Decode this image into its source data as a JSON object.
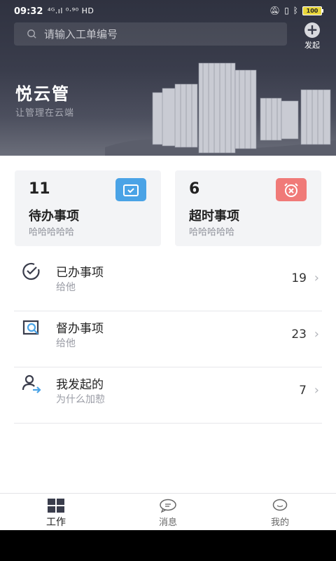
{
  "status_bar": {
    "time": "09:32",
    "network": "⁴ᴳ.ıl ⁰·⁹⁰ HD",
    "battery": "100"
  },
  "search": {
    "placeholder": "请输入工单编号"
  },
  "launch": {
    "label": "发起"
  },
  "brand": {
    "title": "悦云管",
    "subtitle": "让管理在云端"
  },
  "cards": [
    {
      "count": "11",
      "title": "待办事项",
      "subtitle": "哈哈哈哈哈",
      "color": "#4aa3e6"
    },
    {
      "count": "6",
      "title": "超时事项",
      "subtitle": "哈哈哈哈哈",
      "color": "#f07a78"
    }
  ],
  "list": [
    {
      "title": "已办事项",
      "subtitle": "给他",
      "count": "19",
      "icon": "check-circle-icon"
    },
    {
      "title": "督办事项",
      "subtitle": "给他",
      "count": "23",
      "icon": "search-doc-icon"
    },
    {
      "title": "我发起的",
      "subtitle": "为什么加愸",
      "count": "7",
      "icon": "user-send-icon"
    }
  ],
  "tabs": [
    {
      "label": "工作",
      "icon": "grid-icon",
      "active": true
    },
    {
      "label": "消息",
      "icon": "chat-icon",
      "active": false
    },
    {
      "label": "我的",
      "icon": "profile-icon",
      "active": false
    }
  ]
}
